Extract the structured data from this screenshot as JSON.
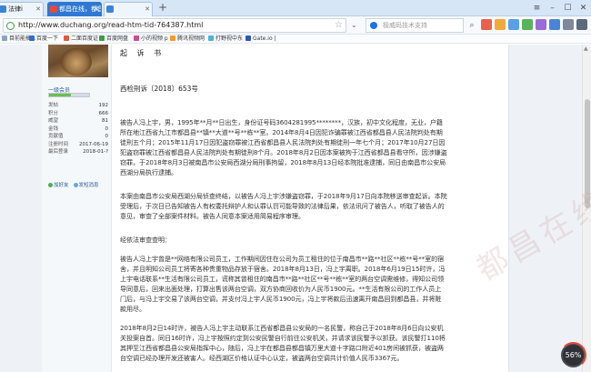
{
  "browser": {
    "tabs": [
      {
        "label": "法律i",
        "active": false
      },
      {
        "label": "都昌在线，都昌人自己的",
        "active": true
      },
      {
        "label": "",
        "active": false
      }
    ],
    "address_bar": {
      "url": "http://www.duchang.org/read-htm-tid-764387.html"
    },
    "search_box": {
      "placeholder": "极威码技术支持"
    },
    "bookmarks": [
      {
        "label": "目前能搞..."
      },
      {
        "label": "百度一下"
      },
      {
        "label": "二面百度证"
      },
      {
        "label": "百度网盘"
      },
      {
        "label": "小的视频 p"
      },
      {
        "label": "腾讯视频网"
      },
      {
        "label": "打野视中东"
      },
      {
        "label": "Gate.io |"
      }
    ],
    "colors": {
      "accent": "#2f78d3",
      "chrome": "#d6e6f7"
    }
  },
  "sidebar": {
    "username": "一级会员",
    "level_progress": 0.55,
    "stats": [
      {
        "label": "发帖",
        "value": "192"
      },
      {
        "label": "积分",
        "value": "666"
      },
      {
        "label": "威望",
        "value": "81"
      },
      {
        "label": "金钱",
        "value": "0"
      },
      {
        "label": "贡献值",
        "value": "0"
      },
      {
        "label": "注册时间",
        "value": "2017-06-19"
      },
      {
        "label": "最后登录",
        "value": "2018-01-?"
      }
    ],
    "actions": [
      {
        "label": "加好友"
      },
      {
        "label": "发短消息"
      }
    ]
  },
  "post": {
    "title": "起 诉 书",
    "doc_number": "西检刑诉〔2018〕653号",
    "paragraphs": [
      "被告人冯上宇，男，1995年**月**日出生，身份证号码3604281995********，汉族，初中文化程度，无业，户籍所在地江西省九江市都昌县**镇**大道**号**栋**室。2014年8月4日因犯诈骗罪被江西省都昌县人民法院判处有期徒刑五个月；2015年11月17日因犯盗窃罪被江西省都昌县人民法院判处有期徒刑一年七个月；2017年10月27日因犯盗窃罪被江西省都昌县人民法院判处有期徒刑8个月。2018年8月2日因本案被拘于江西省都昌县看守所，因涉嫌盗窃罪，于2018年8月3日被南昌市公安局西湖分局刑事拘留，2018年8月13日经本院批准逮捕，同日由南昌市公安局西湖分局执行逮捕。",
      "本案由南昌市公安局西湖分局侦查终结，以被告人冯上宇涉嫌盗窃罪，于2018年9月17日向本院移送审查起诉。本院受理后，于次日已告知被告人有权委托辩护人和认罪认罚可能导致的法律后果，依法讯问了被告人，听取了被告人的意见，审查了全部案件材料。被告人同意本案适用简易程序审理。",
      "经依法审查查明：",
      "被告人冯上宇曾是**网络有限公司员工，工作期间因住在公司为员工租住的位于南昌市**路**社区**栋**号**室的宿舍，并且明知公司员工将寄各种贵重物品存放于宿舍。2018年8月13日，冯上宇离职。2018年6月19日15时许，冯上宇电话联系**生活有限公司员工，谎称其曾租住的南昌市**路**社区**号**栋**室的两台空调需维修，得知公司领导同意后，回来出面处理，打算出售该两台空调，双方协商回收价为人民币1900元。**生活有限公司的工作人员上门后，与冯上宇交易了该两台空调，并支付冯上宇人民币1900元，冯上宇将款后迅速离开南昌回到都昌县，并将赃款用尽。",
      "2018年8月2日14时许，被告人冯上宇主动联系江西省都昌县公安局的一名民警，称自己于2018年8月6日向公安机关投案自首。同日16时许，冯上宇按照约定到公安民警自行前往公安机关，并请求该民警予以抓获。该民警打110将其押至江西省都昌县公安局指挥中心，随后，冯上宇在都昌县都昌镇万里大道十字路口附近401房间被抓获，被盗两台空调已经办理开发还被害人。经西湖区价格认证中心认定，被盗两台空调共计价值人民币3367元。"
    ]
  },
  "watermark": {
    "text": "都昌在线"
  },
  "widget": {
    "value": "56%"
  }
}
